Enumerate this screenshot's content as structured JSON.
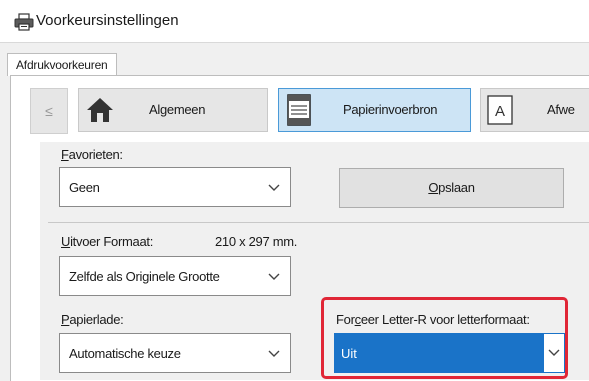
{
  "window": {
    "title": "Voorkeursinstellingen"
  },
  "tabs": {
    "outer_tab": "Afdrukvoorkeuren"
  },
  "nav": {
    "prev_symbol": "≤",
    "items": [
      {
        "label": "Algemeen",
        "icon": "home-icon"
      },
      {
        "label": "Papierinvoerbron",
        "icon": "paper-tray-icon"
      },
      {
        "label": "Afwe",
        "icon": "text-a-icon"
      }
    ]
  },
  "favorites": {
    "label": "Favorieten:",
    "value": "Geen",
    "save_label": "Opslaan"
  },
  "output_size": {
    "label": "Uitvoer Formaat:",
    "dimensions": "210 x 297",
    "unit": "mm.",
    "value": "Zelfde als Originele Grootte"
  },
  "paper_tray": {
    "label": "Papierlade:",
    "value": "Automatische keuze"
  },
  "force_letter": {
    "label": "Forceer Letter-R voor letterformaat:",
    "value": "Uit"
  },
  "colors": {
    "highlight": "#e02636",
    "selection": "#1a73c8",
    "active_tab_bg": "#cde4f5"
  }
}
